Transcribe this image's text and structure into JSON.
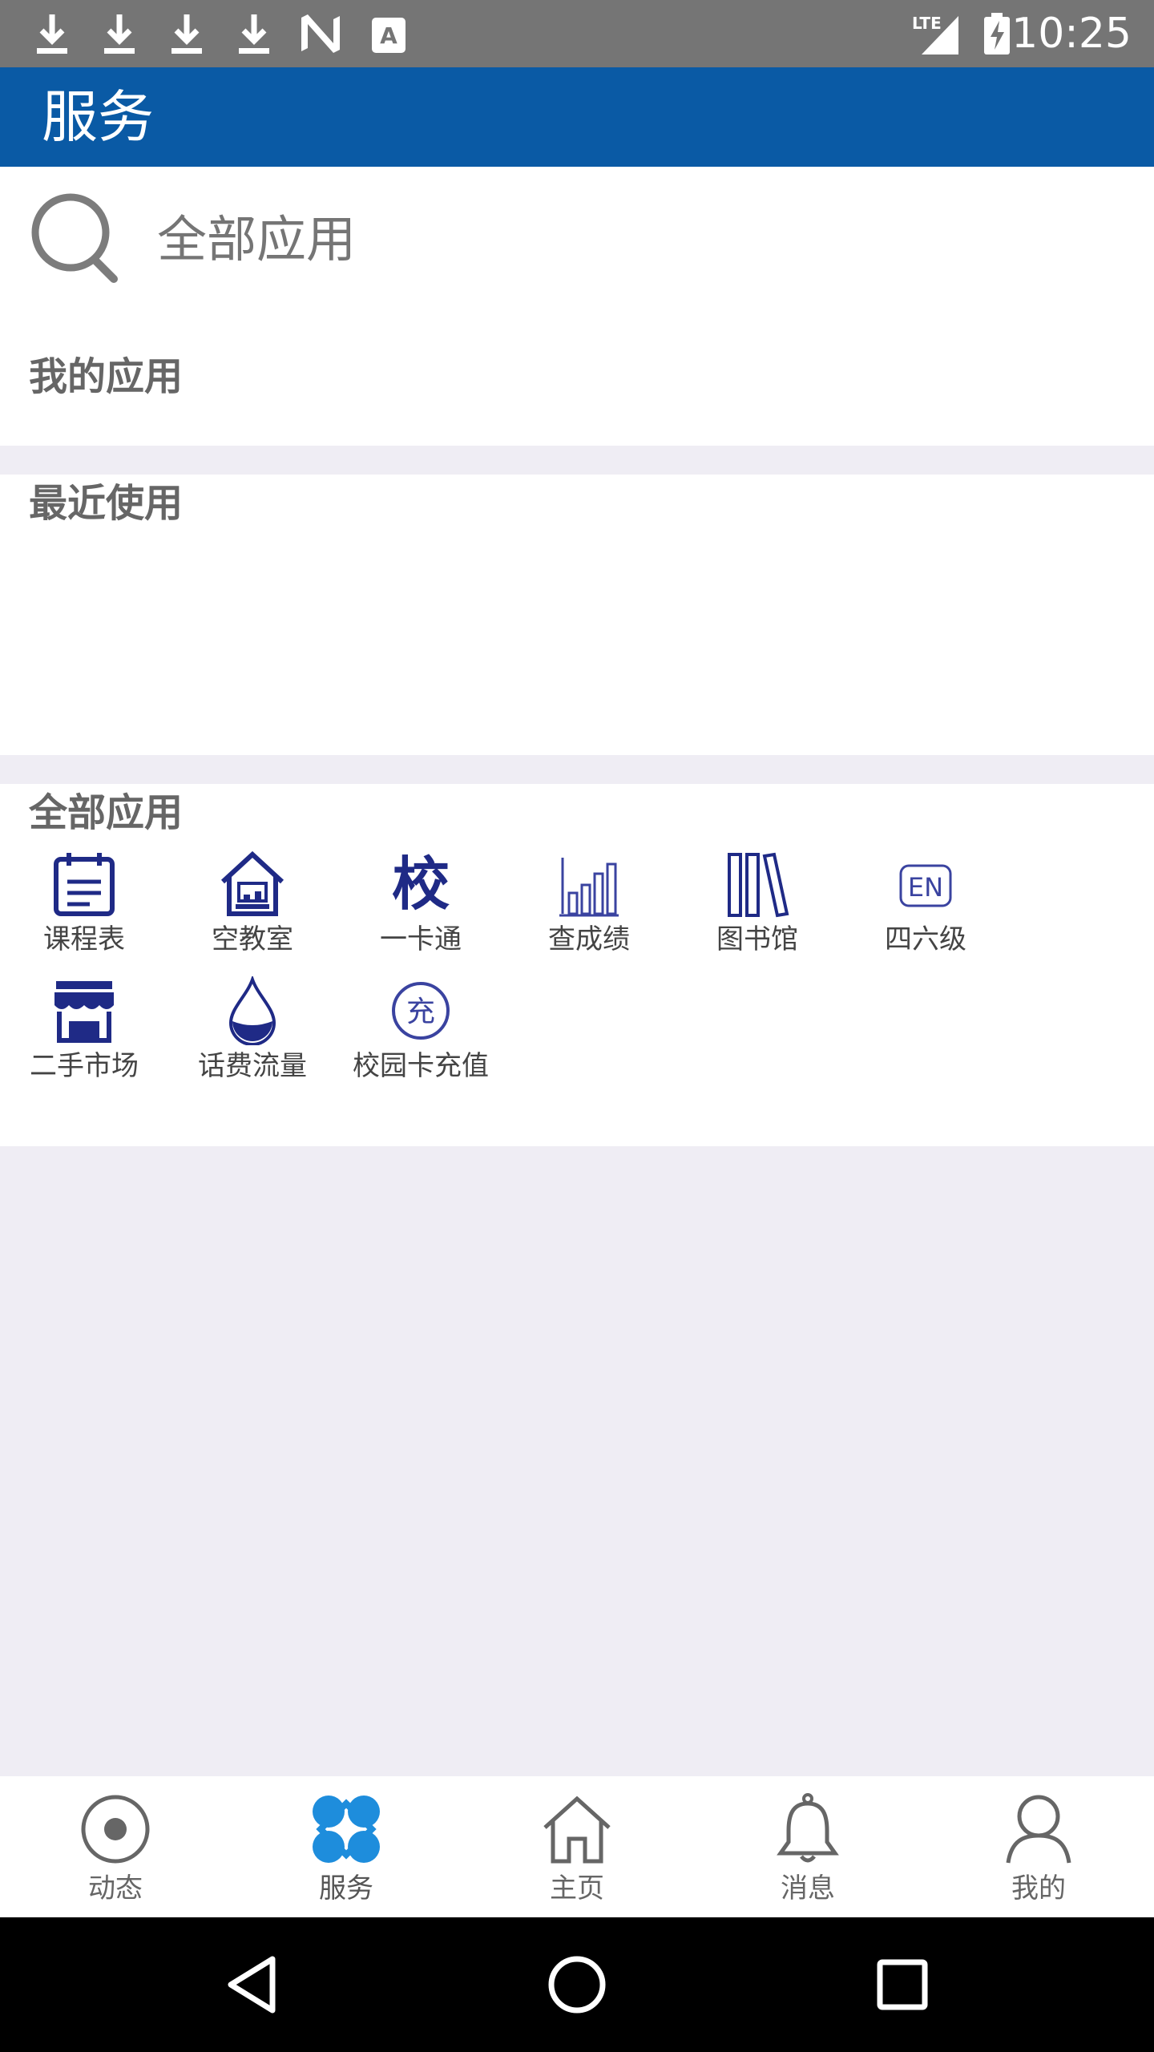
{
  "status_bar": {
    "time": "10:25",
    "network": "LTE",
    "icons": [
      "download-icon",
      "download-icon",
      "download-icon",
      "download-icon",
      "n-logo-icon",
      "a-notification-icon",
      "lte-signal-icon",
      "battery-charging-icon"
    ]
  },
  "app_bar": {
    "title": "服务"
  },
  "search": {
    "placeholder": "全部应用"
  },
  "sections": {
    "my_apps": "我的应用",
    "recent": "最近使用",
    "all_apps": "全部应用"
  },
  "apps": [
    {
      "label": "课程表",
      "icon": "calendar-icon"
    },
    {
      "label": "空教室",
      "icon": "classroom-icon"
    },
    {
      "label": "一卡通",
      "icon": "campus-card-icon",
      "glyph": "校"
    },
    {
      "label": "查成绩",
      "icon": "bar-chart-icon"
    },
    {
      "label": "图书馆",
      "icon": "books-icon"
    },
    {
      "label": "四六级",
      "icon": "en-icon",
      "glyph": "EN"
    },
    {
      "label": "二手市场",
      "icon": "store-icon"
    },
    {
      "label": "话费流量",
      "icon": "water-drop-icon"
    },
    {
      "label": "校园卡充值",
      "icon": "recharge-icon",
      "glyph": "充"
    }
  ],
  "bottom_nav": [
    {
      "label": "动态",
      "icon": "record-icon",
      "active": false
    },
    {
      "label": "服务",
      "icon": "services-icon",
      "active": true
    },
    {
      "label": "主页",
      "icon": "home-icon",
      "active": false
    },
    {
      "label": "消息",
      "icon": "bell-icon",
      "active": false
    },
    {
      "label": "我的",
      "icon": "user-icon",
      "active": false
    }
  ],
  "colors": {
    "app_bar": "#0a5aa5",
    "status_bar": "#757575",
    "active_nav": "#1e8ddc",
    "icon_navy": "#1f2a86",
    "section_gray": "#efedf4"
  }
}
